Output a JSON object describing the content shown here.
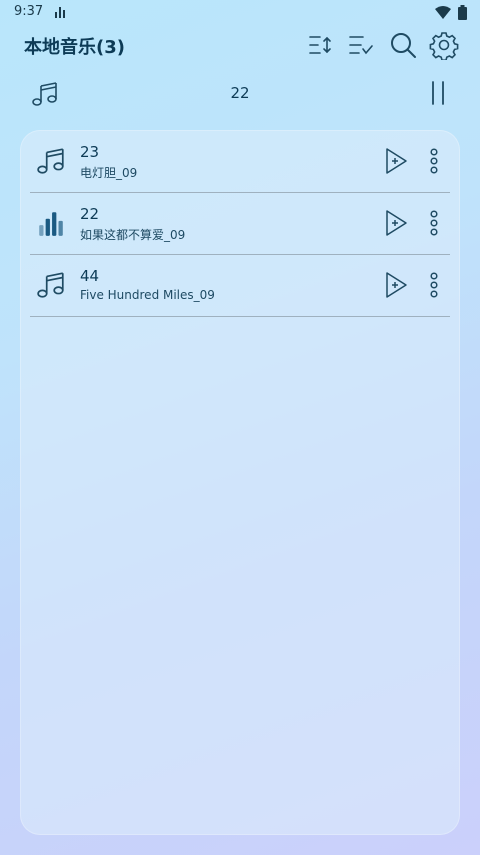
{
  "status_bar": {
    "time": "9:37"
  },
  "header": {
    "title": "本地音乐(3)"
  },
  "toolbar": {
    "icons": [
      "sort-icon",
      "multi-select-icon",
      "search-icon",
      "settings-icon"
    ]
  },
  "now_playing": {
    "title": "22",
    "state": "playing"
  },
  "songs": [
    {
      "title": "23",
      "subtitle": "电灯胆_09",
      "playing": false
    },
    {
      "title": "22",
      "subtitle": "如果这都不算爱_09",
      "playing": true
    },
    {
      "title": "44",
      "subtitle": "Five Hundred Miles_09",
      "playing": false
    }
  ],
  "colors": {
    "accent": "#0d3b56",
    "icon": "#1f4b63",
    "playing_bars": "#1a5a82"
  }
}
